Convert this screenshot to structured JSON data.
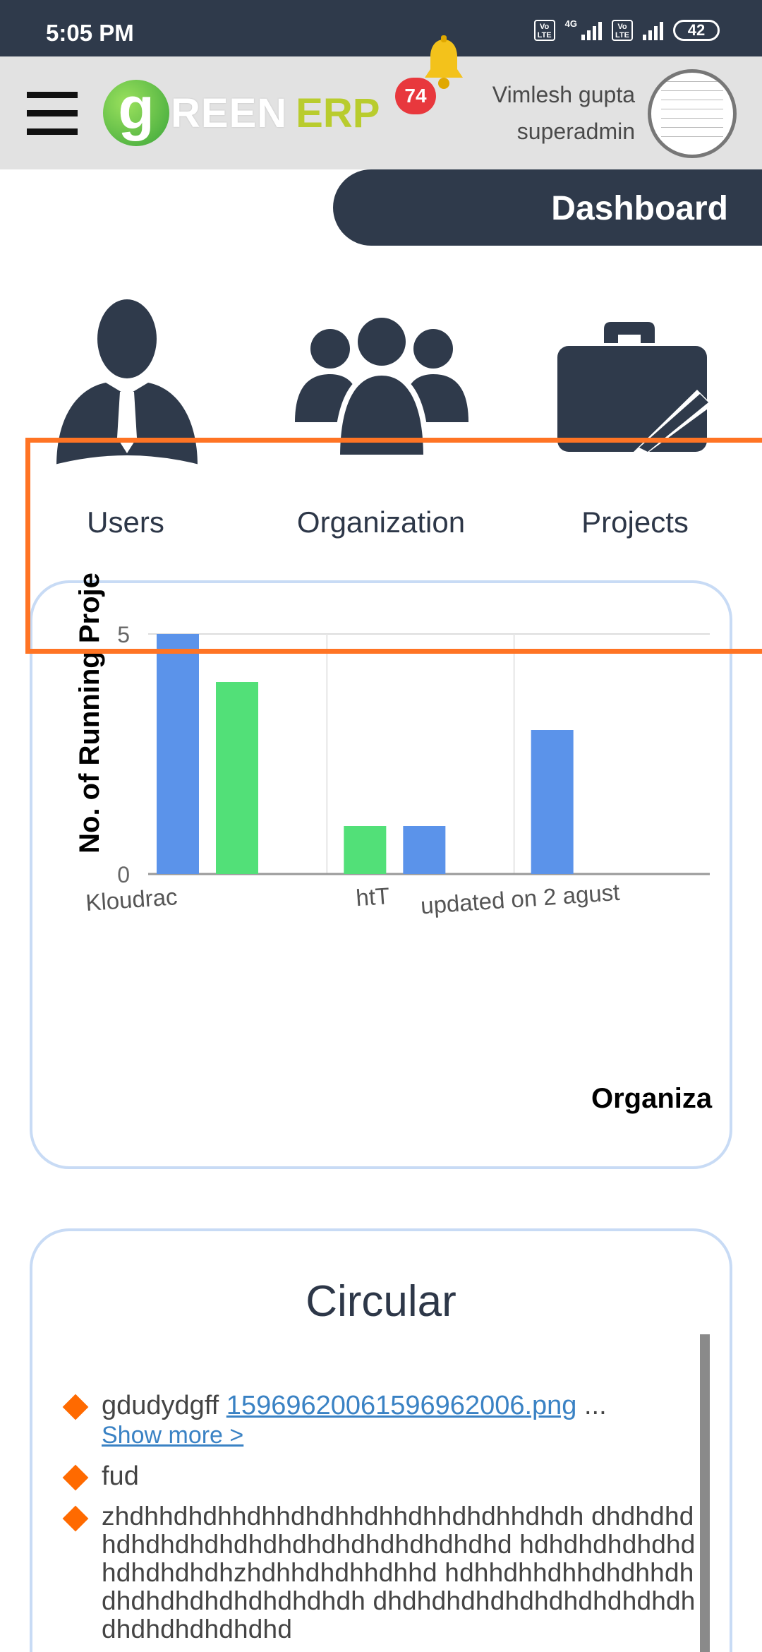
{
  "status_bar": {
    "time": "5:05 PM",
    "network": "4G",
    "volte_label": "Vo LTE",
    "battery": "42"
  },
  "header": {
    "logo_g": "g",
    "logo_reen": "REEN",
    "logo_erp": "ERP",
    "notification_count": "74",
    "user_name": "Vimlesh gupta",
    "user_role": "superadmin"
  },
  "dashboard_label": "Dashboard",
  "quick_links": [
    {
      "label": "Users",
      "icon": "user-icon"
    },
    {
      "label": "Organization",
      "icon": "group-icon"
    },
    {
      "label": "Projects",
      "icon": "briefcase-icon"
    }
  ],
  "chart_data": {
    "type": "bar",
    "title": "",
    "ylabel": "No. of Running Proje",
    "xlabel": "Organiza",
    "ylim": [
      0,
      5
    ],
    "yticks": [
      "0",
      "5"
    ],
    "categories": [
      "Kloudrac",
      "htT",
      "updated on 2 agust"
    ],
    "bars": [
      {
        "category": "Kloudrac",
        "value": 5,
        "color": "#5b93ea"
      },
      {
        "category": "Kloudrac",
        "value": 4,
        "color": "#52e078"
      },
      {
        "category": "htT",
        "value": 1,
        "color": "#52e078"
      },
      {
        "category": "htT",
        "value": 1,
        "color": "#5b93ea"
      },
      {
        "category": "updated on 2 agust",
        "value": 3,
        "color": "#5b93ea"
      }
    ],
    "grid": true
  },
  "circular": {
    "title": "Circular",
    "items": [
      {
        "text": "gdudydgff",
        "link": "15969620061596962006.png",
        "ellipsis": "...",
        "show_more": "Show more >"
      },
      {
        "text": "fud"
      },
      {
        "text": "zhdhhdhdhhdhhdhdhhdhhdhhdhdhhdhdh dhdhdhdhdhdhdhdhdhdhdhdhdhdhdhdhdhd hdhdhdhdhdhdhdhdhdhdhzhdhhdhdhhdhhd hdhhdhhdhhdhdhhdhdhdhdhdhdhdhdhdhdh dhdhdhdhdhdhdhdhdhdhdhdhdhdhdhdhdhd"
      }
    ]
  },
  "colors": {
    "dark": "#2f3a4b",
    "highlight": "#ff7424",
    "card_border": "#c8dbf5",
    "bar_blue": "#5b93ea",
    "bar_green": "#52e078",
    "bullet": "#ff6a00"
  }
}
